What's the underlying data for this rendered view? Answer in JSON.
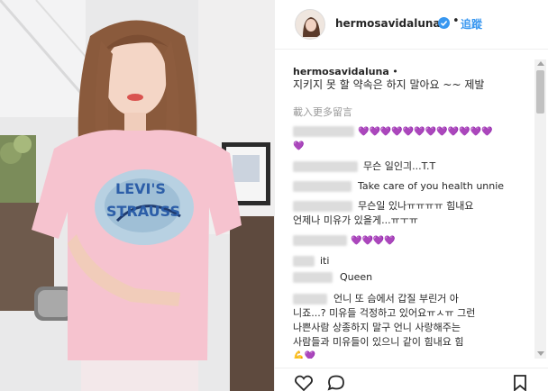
{
  "post": {
    "username": "hermosavidaluna",
    "follow_label": "追蹤",
    "caption": "지키지 못 할 약속은 하지 말아요 ~~ 제발"
  },
  "comments": {
    "load_more_label": "載入更多留言",
    "items": [
      {
        "text": "💜💜💜💜💜💜💜💜💜💜💜💜",
        "wrap": "💜"
      },
      {
        "text": "무슨 일인긔...T.T"
      },
      {
        "text": "Take care of you health unnie"
      },
      {
        "text": "무슨일 있나ㅠㅠㅠㅠ 힘내요",
        "line2": "언제나 미유가 있을게...ㅠㅜㅠ"
      },
      {
        "text": "💜💜💜💜"
      },
      {
        "text": "iti"
      },
      {
        "text": "Queen"
      },
      {
        "text": "언니 또 슴에서 갑질 부린거 아",
        "line2": "니죠...? 미유들 걱정하고 있어요ㅠㅅㅠ 그런",
        "line3": "나쁜사람 상종하지 말구 언니 사랑해주는",
        "line4": "사람들과 미유들이 있으니 같이 힘내요 힘",
        "line5": "💪💜"
      }
    ]
  },
  "photo": {
    "shirt_text_1": "LEVI'S",
    "shirt_text_2": "STRAUSS"
  },
  "icons": {
    "like": "heart-icon",
    "comment": "comment-icon",
    "save": "bookmark-icon",
    "verified": "verified-badge-icon"
  },
  "colors": {
    "follow": "#3897f0",
    "hearts": "#b59af0"
  }
}
